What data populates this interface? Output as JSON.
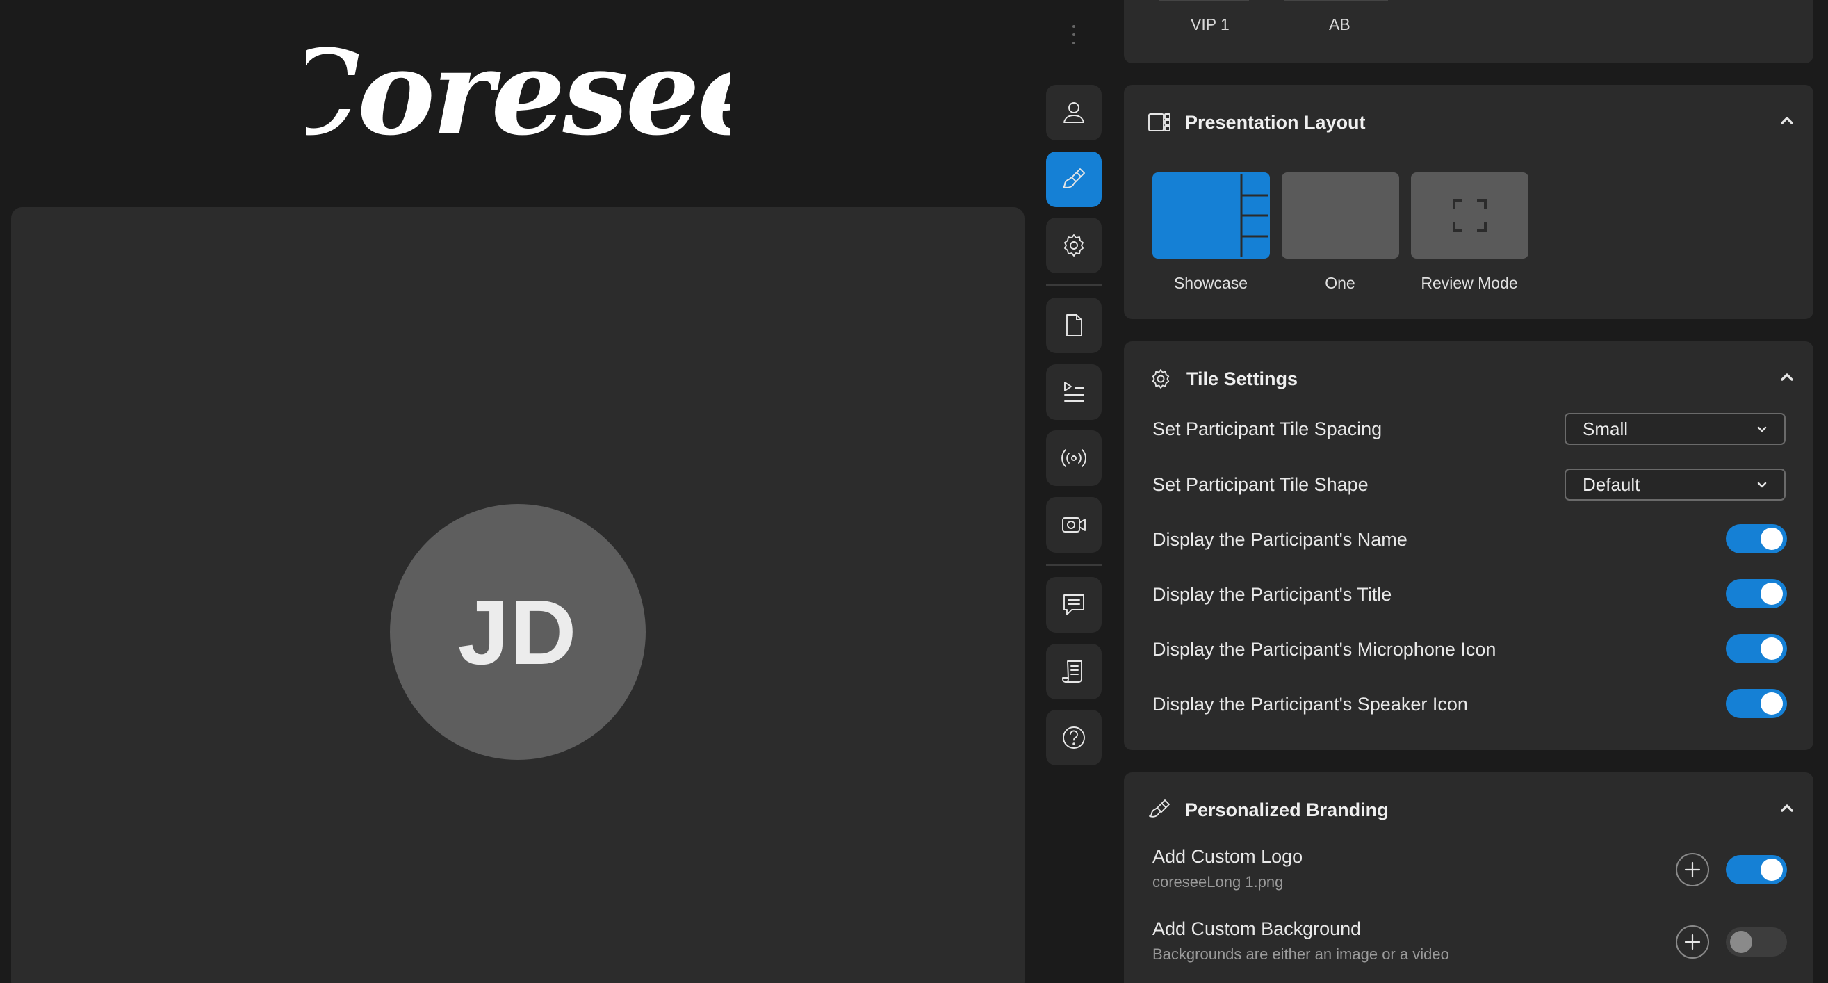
{
  "brand": {
    "logo_text": "Coresee"
  },
  "participant": {
    "initials": "JD"
  },
  "top_tabs": {
    "items": [
      {
        "label": "VIP 1"
      },
      {
        "label": "AB"
      }
    ]
  },
  "presentation_layout": {
    "title": "Presentation Layout",
    "options": [
      {
        "label": "Showcase",
        "selected": true
      },
      {
        "label": "One",
        "selected": false
      },
      {
        "label": "Review Mode",
        "selected": false
      }
    ]
  },
  "tile_settings": {
    "title": "Tile Settings",
    "spacing": {
      "label": "Set Participant Tile Spacing",
      "value": "Small"
    },
    "shape": {
      "label": "Set Participant Tile Shape",
      "value": "Default"
    },
    "toggles": [
      {
        "label": "Display the Participant's Name",
        "on": true
      },
      {
        "label": "Display the Participant's Title",
        "on": true
      },
      {
        "label": "Display the Participant's Microphone Icon",
        "on": true
      },
      {
        "label": "Display the Participant's Speaker Icon",
        "on": true
      }
    ]
  },
  "branding": {
    "title": "Personalized Branding",
    "logo": {
      "label": "Add Custom Logo",
      "sub": "coreseeLong 1.png",
      "on": true
    },
    "background": {
      "label": "Add Custom Background",
      "sub": "Backgrounds are either an image or a video",
      "on": false
    }
  },
  "colors": {
    "accent": "#1580d5",
    "stage": "#2c2c2c",
    "app_bg": "#1b1b1b",
    "card": "#2b2b2b"
  },
  "icons": {
    "rail": [
      "user-icon",
      "brush-icon",
      "settings-icon",
      "document-icon",
      "playlist-icon",
      "broadcast-icon",
      "camera-icon",
      "chat-icon",
      "script-icon",
      "help-icon"
    ]
  }
}
